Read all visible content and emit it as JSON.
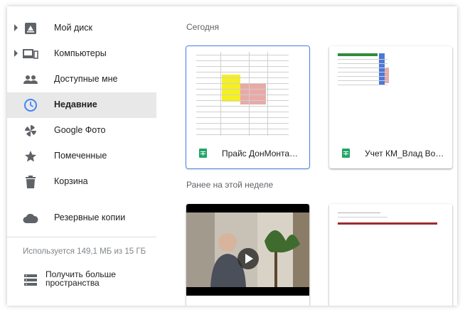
{
  "sidebar": {
    "items": [
      {
        "label": "Мой диск",
        "icon": "drive-icon",
        "expandable": true,
        "active": false
      },
      {
        "label": "Компьютеры",
        "icon": "computers-icon",
        "expandable": true,
        "active": false
      },
      {
        "label": "Доступные мне",
        "icon": "shared-people-icon",
        "expandable": false,
        "active": false
      },
      {
        "label": "Недавние",
        "icon": "clock-icon",
        "expandable": false,
        "active": true
      },
      {
        "label": "Google Фото",
        "icon": "photos-pinwheel-icon",
        "expandable": false,
        "active": false
      },
      {
        "label": "Помеченные",
        "icon": "star-icon",
        "expandable": false,
        "active": false
      },
      {
        "label": "Корзина",
        "icon": "trash-icon",
        "expandable": false,
        "active": false
      },
      {
        "label": "Резервные копии",
        "icon": "cloud-icon",
        "expandable": false,
        "active": false
      }
    ],
    "storage_text": "Используется 149,1 МБ из 15 ГБ",
    "upgrade_label": "Получить больше пространства"
  },
  "main": {
    "sections": [
      {
        "title": "Сегодня",
        "files": [
          {
            "name": "Прайс ДонМонта…",
            "type": "spreadsheet",
            "selected": true
          },
          {
            "name": "Учет КМ_Влад Во…",
            "type": "spreadsheet",
            "selected": false
          }
        ]
      },
      {
        "title": "Ранее на этой неделе",
        "files": [
          {
            "name": "",
            "type": "video",
            "selected": false
          },
          {
            "name": "",
            "type": "spreadsheet",
            "selected": false
          }
        ]
      }
    ]
  },
  "colors": {
    "active_bg": "#e8e8e8",
    "accent_blue": "#4285f4",
    "sheets_green": "#23a566",
    "icon_gray": "#5f6368"
  }
}
